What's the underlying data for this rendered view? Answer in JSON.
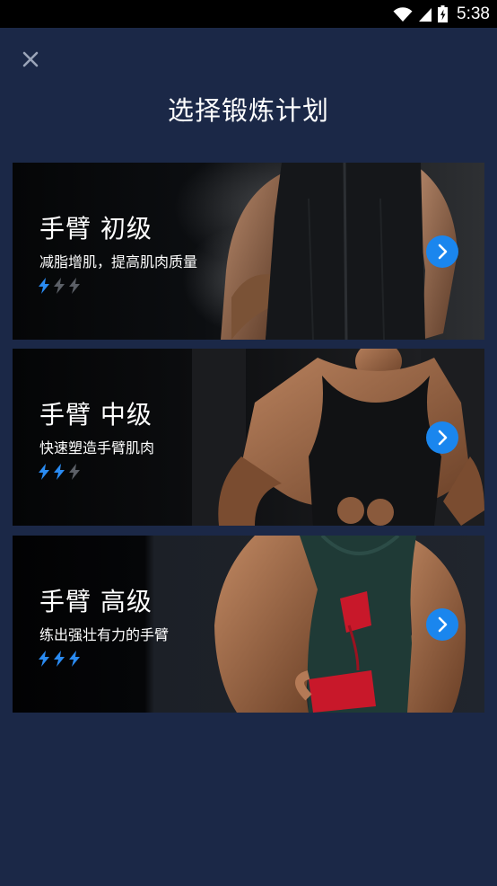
{
  "status_bar": {
    "time": "5:38"
  },
  "header": {
    "title": "选择锻炼计划"
  },
  "colors": {
    "background": "#1b2847",
    "accent": "#1a86ee",
    "bolt_active": "#2a8bf2",
    "bolt_inactive": "#5b5f66"
  },
  "plans": [
    {
      "title": "手臂 初级",
      "subtitle": "减脂增肌，提高肌肉质量",
      "difficulty": 1,
      "max_difficulty": 3
    },
    {
      "title": "手臂 中级",
      "subtitle": "快速塑造手臂肌肉",
      "difficulty": 2,
      "max_difficulty": 3
    },
    {
      "title": "手臂 高级",
      "subtitle": "练出强壮有力的手臂",
      "difficulty": 3,
      "max_difficulty": 3
    }
  ]
}
